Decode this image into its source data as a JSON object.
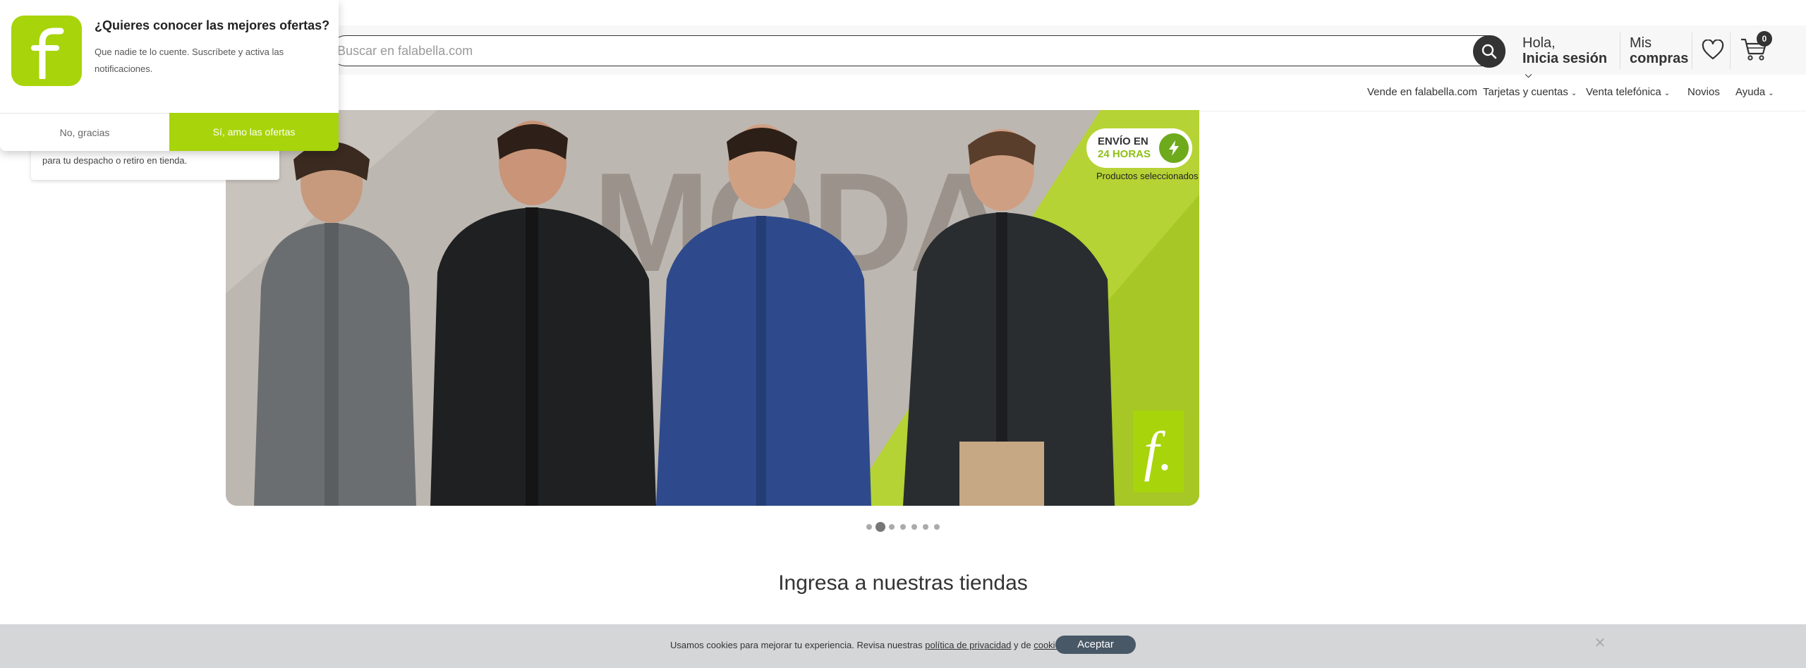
{
  "header": {
    "search_placeholder": "Buscar en falabella.com",
    "account": {
      "greeting": "Hola,",
      "action": "Inicia sesión"
    },
    "orders": {
      "line1": "Mis",
      "line2": "compras"
    },
    "cart_count": "0"
  },
  "nav": [
    {
      "label": "Vende en falabella.com",
      "dropdown": false
    },
    {
      "label": "Tarjetas y cuentas",
      "dropdown": true
    },
    {
      "label": "Venta telefónica",
      "dropdown": true
    },
    {
      "label": "Novios",
      "dropdown": false
    },
    {
      "label": "Ayuda",
      "dropdown": true
    }
  ],
  "banner": {
    "headline": "MODA",
    "badge_line1": "ENVÍO EN",
    "badge_line2": "24 HORAS",
    "badge_sub": "Productos seleccionados",
    "logo_glyph": "f.",
    "colors": {
      "lime": "#a8d40b",
      "background": "#b9b3ae"
    }
  },
  "carousel": {
    "count": 7,
    "active": 1
  },
  "section_title": "Ingresa a nuestras tiendas",
  "location_card": {
    "text": "para tu despacho o retiro en tienda."
  },
  "notification_popup": {
    "title": "¿Quieres conocer las mejores ofertas?",
    "body": "Que nadie te lo cuente. Suscríbete y activa las notificaciones.",
    "decline": "No, gracias",
    "accept": "Sí, amo las ofertas"
  },
  "cookies": {
    "text_before": "Usamos cookies para mejorar tu experiencia. Revisa nuestras ",
    "link_privacy": "política de privacidad",
    "text_middle": " y de ",
    "link_cookies": "cookies",
    "text_after": ".",
    "accept": "Aceptar"
  },
  "icons": {
    "search": "search-icon",
    "heart": "heart-icon",
    "cart": "cart-icon",
    "close": "close-icon",
    "chevron": "chevron-down-icon",
    "bolt": "lightning-icon"
  }
}
